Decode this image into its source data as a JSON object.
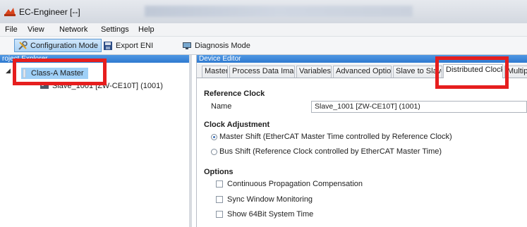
{
  "window": {
    "title": "EC-Engineer [--]"
  },
  "menu": [
    "File",
    "View",
    "Network",
    "Settings",
    "Help"
  ],
  "toolbar": {
    "configuration_mode": "Configuration Mode",
    "export_eni": "Export ENI",
    "diagnosis_mode": "Diagnosis Mode"
  },
  "project_explorer": {
    "header": "roject Explorer",
    "master": "Class-A Master",
    "slave": "Slave_1001 [ZW-CE10T] (1001)"
  },
  "device_editor": {
    "header": "Device Editor",
    "tabs": [
      "Master",
      "Process Data Image",
      "Variables",
      "Advanced Options",
      "Slave to Slave",
      "Distributed Clocks",
      "Multiple"
    ],
    "active_tab": "Distributed Clocks",
    "reference_clock": {
      "title": "Reference Clock",
      "name_label": "Name",
      "name_value": "Slave_1001 [ZW-CE10T] (1001)"
    },
    "clock_adjustment": {
      "title": "Clock Adjustment",
      "master_shift": "Master Shift (EtherCAT Master Time controlled by Reference Clock)",
      "bus_shift": "Bus Shift (Reference Clock controlled by EtherCAT Master Time)",
      "selected": "master_shift"
    },
    "options": {
      "title": "Options",
      "items": [
        "Continuous Propagation Compensation",
        "Sync Window Monitoring",
        "Show 64Bit System Time"
      ]
    }
  },
  "colors": {
    "highlight": "#e61e1e",
    "pane_header": "#3a86d8",
    "selection": "#9fd0f7"
  },
  "icons": [
    "app-logo-icon",
    "configuration-mode-icon",
    "export-eni-icon",
    "diagnosis-mode-icon",
    "master-node-icon",
    "slave-device-icon"
  ]
}
